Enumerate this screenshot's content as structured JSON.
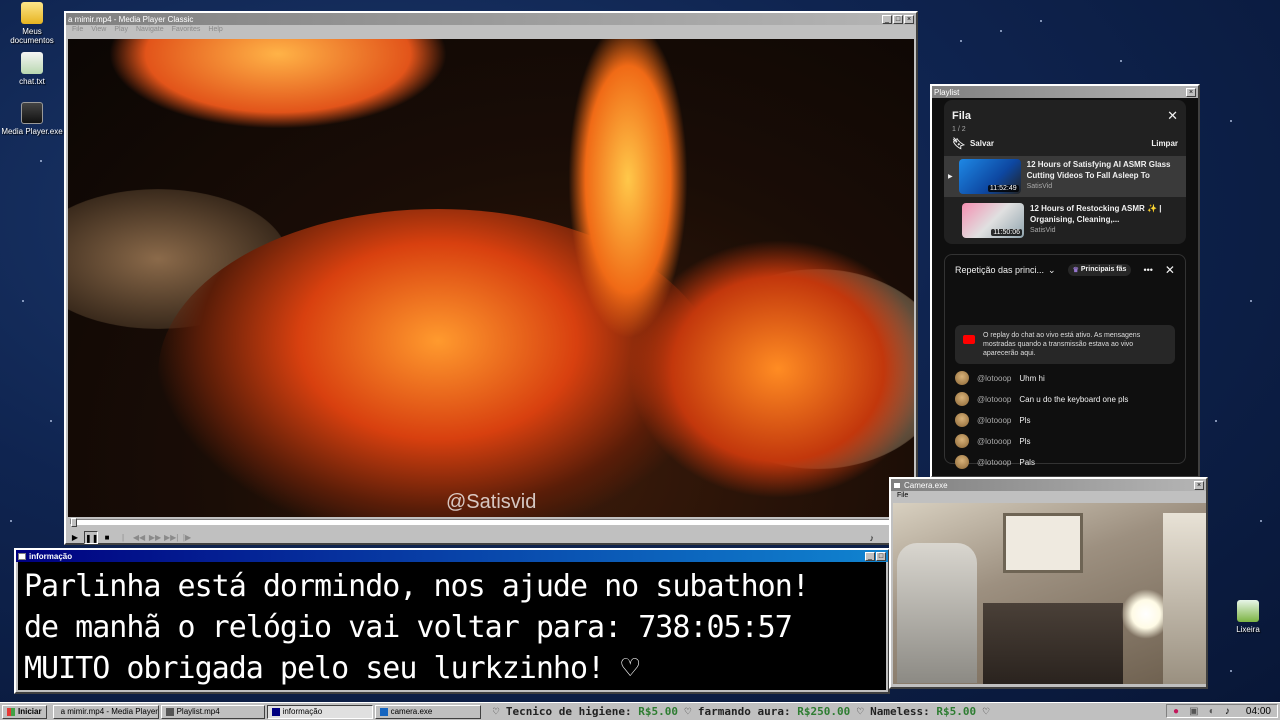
{
  "desktop": {
    "icons": [
      {
        "label": "Meus documentos"
      },
      {
        "label": "chat.txt"
      },
      {
        "label": "Media Player.exe"
      },
      {
        "label": "Lixeira"
      }
    ]
  },
  "player": {
    "title": "a mimir.mp4 - Media Player Classic",
    "menu": [
      "File",
      "View",
      "Play",
      "Navigate",
      "Favorites",
      "Help"
    ],
    "watermark": "@Satisvid",
    "progress": 0.0
  },
  "playlist": {
    "window_title": "Playlist",
    "queue_title": "Fila",
    "queue_position": "1 / 2",
    "save_label": "Salvar",
    "clear_label": "Limpar",
    "items": [
      {
        "title": "12 Hours of Satisfying AI ASMR Glass Cutting Videos To Fall Asleep To",
        "channel": "SatisVid",
        "duration": "11:52:49",
        "playing": true
      },
      {
        "title": "12 Hours of Restocking ASMR ✨ | Organising, Cleaning,...",
        "channel": "SatisVid",
        "duration": "11:50:06",
        "playing": false
      }
    ],
    "chat": {
      "header": "Repetição das princi...",
      "filter_badge": "Principais fãs",
      "notice": "O replay do chat ao vivo está ativo. As mensagens mostradas quando a transmissão estava ao vivo aparecerão aqui.",
      "messages": [
        {
          "user": "@lotooop",
          "text": "Uhm hi"
        },
        {
          "user": "@lotooop",
          "text": "Can u do the keyboard one pls"
        },
        {
          "user": "@lotooop",
          "text": "Pls"
        },
        {
          "user": "@lotooop",
          "text": "Pls"
        },
        {
          "user": "@lotooop",
          "text": "Pals"
        }
      ]
    }
  },
  "info": {
    "window_title": "informação",
    "lines": [
      "Parlinha está dormindo, nos ajude no subathon!",
      "de manhã o relógio vai voltar para:  738:05:57",
      "MUITO obrigada pelo seu lurkzinho! ♡"
    ]
  },
  "camera": {
    "window_title": "Camera.exe",
    "menu": [
      "File"
    ]
  },
  "taskbar": {
    "start_label": "Iniciar",
    "tasks": [
      {
        "label": "a mimir.mp4 - Media Player...",
        "active": false
      },
      {
        "label": "Playlist.mp4",
        "active": false
      },
      {
        "label": "informação",
        "active": true
      },
      {
        "label": "camera.exe",
        "active": false
      }
    ],
    "ticker": [
      {
        "label": "♡ Tecnico de higiene: ",
        "amount": "R$5.00"
      },
      {
        "label": " ♡ farmando aura: ",
        "amount": "R$250.00"
      },
      {
        "label": " ♡ Nameless: ",
        "amount": "R$5.00"
      },
      {
        "label": " ♡",
        "amount": ""
      }
    ],
    "clock": "04:00"
  }
}
